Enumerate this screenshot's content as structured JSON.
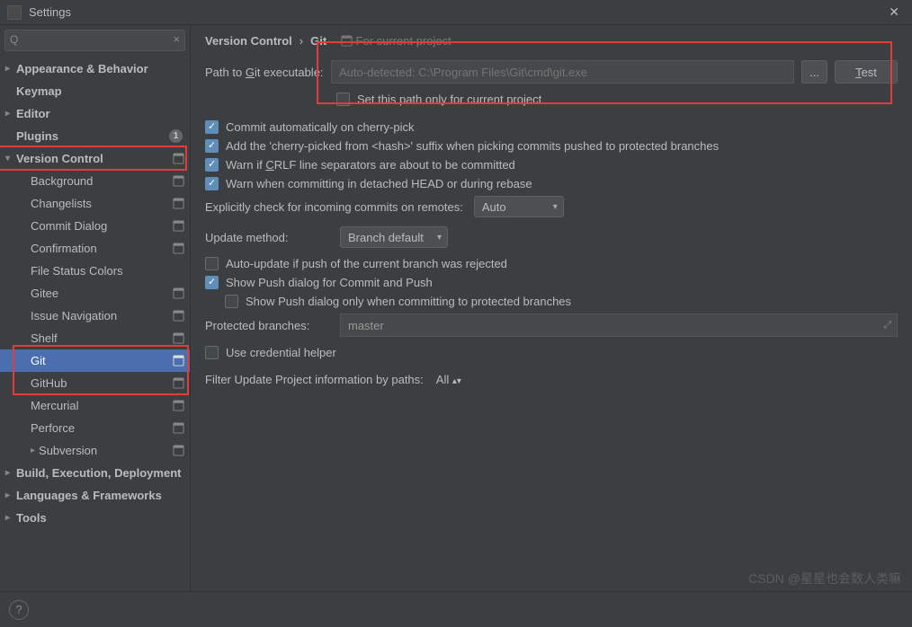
{
  "window": {
    "title": "Settings"
  },
  "search": {
    "placeholder": ""
  },
  "sidebar": {
    "items": [
      {
        "label": "Appearance & Behavior"
      },
      {
        "label": "Keymap"
      },
      {
        "label": "Editor"
      },
      {
        "label": "Plugins",
        "badge": "1"
      },
      {
        "label": "Version Control"
      },
      {
        "label": "Background"
      },
      {
        "label": "Changelists"
      },
      {
        "label": "Commit Dialog"
      },
      {
        "label": "Confirmation"
      },
      {
        "label": "File Status Colors"
      },
      {
        "label": "Gitee"
      },
      {
        "label": "Issue Navigation"
      },
      {
        "label": "Shelf"
      },
      {
        "label": "Git"
      },
      {
        "label": "GitHub"
      },
      {
        "label": "Mercurial"
      },
      {
        "label": "Perforce"
      },
      {
        "label": "Subversion"
      },
      {
        "label": "Build, Execution, Deployment"
      },
      {
        "label": "Languages & Frameworks"
      },
      {
        "label": "Tools"
      }
    ]
  },
  "breadcrumb": {
    "a": "Version Control",
    "b": "Git",
    "note": "For current project"
  },
  "main": {
    "pathLabel_pre": "Path to ",
    "pathLabel_mn": "G",
    "pathLabel_post": "it executable:",
    "pathPlaceholder": "Auto-detected: C:\\Program Files\\Git\\cmd\\git.exe",
    "browse": "...",
    "test_mn": "T",
    "test_post": "est",
    "setPathOnly": "Set this path only for current project",
    "cherryPick": "Commit automatically on cherry-pick",
    "cherrySuffix": "Add the 'cherry-picked from <hash>' suffix when picking commits pushed to protected branches",
    "crlf_pre": "Warn if ",
    "crlf_mn": "C",
    "crlf_post": "RLF line separators are about to be committed",
    "detached": "Warn when committing in detached HEAD or during rebase",
    "incomingLabel": "Explicitly check for incoming commits on remotes:",
    "incomingValue": "Auto",
    "updateLabel": "Update method:",
    "updateValue": "Branch default",
    "autoUpdate": "Auto-update if push of the current branch was rejected",
    "showPush": "Show Push dialog for Commit and Push",
    "showPushProtected": "Show Push dialog only when committing to protected branches",
    "protectedLabel": "Protected branches:",
    "protectedValue": "master",
    "credHelper": "Use credential helper",
    "filterLabel": "Filter Update Project information by paths:",
    "filterValue": "All"
  },
  "watermark": "CSDN @星星也会数人类嘛"
}
